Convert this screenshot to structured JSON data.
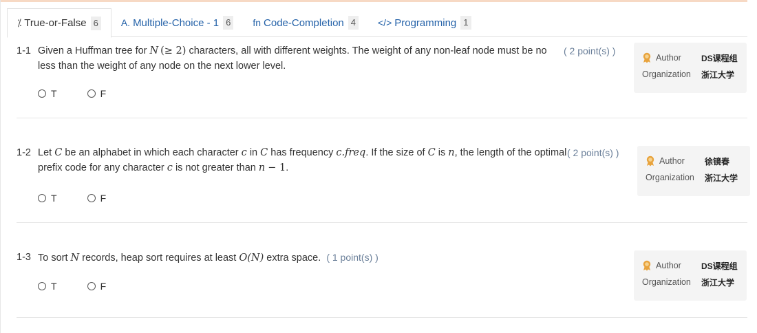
{
  "tabs": [
    {
      "icon": "⁒",
      "label": "True-or-False",
      "count": "6"
    },
    {
      "icon": "A.",
      "label": "Multiple-Choice - 1",
      "count": "6"
    },
    {
      "icon": "fn",
      "label": "Code-Completion",
      "count": "4"
    },
    {
      "icon": "</>",
      "label": "Programming",
      "count": "1"
    }
  ],
  "labels": {
    "author": "Author",
    "organization": "Organization",
    "opt_t": "T",
    "opt_f": "F"
  },
  "problems": [
    {
      "number": "1-1",
      "text_a": "Given a Huffman tree for ",
      "math_a": "N",
      "math_b": "(≥ 2)",
      "text_b": " characters, all with different weights. The weight of any non-leaf node must be no less than the weight of any node on the next lower level.",
      "points": "( 2 point(s) )",
      "author": "DS课程组",
      "organization": "浙江大学"
    },
    {
      "number": "1-2",
      "points": "( 2 point(s) )",
      "author": "徐镜春",
      "organization": "浙江大学"
    },
    {
      "number": "1-3",
      "text_a": "To sort ",
      "math_a": "N",
      "text_b": " records, heap sort requires at least ",
      "math_b": "O(N)",
      "text_c": " extra space.",
      "points": "( 1 point(s) )",
      "author": "DS课程组",
      "organization": "浙江大学"
    }
  ],
  "colors": {
    "tab_text": "#2361a8",
    "points_text": "#6a7f99",
    "card_bg": "#f4f4f4",
    "badge": "#e8a33d"
  }
}
